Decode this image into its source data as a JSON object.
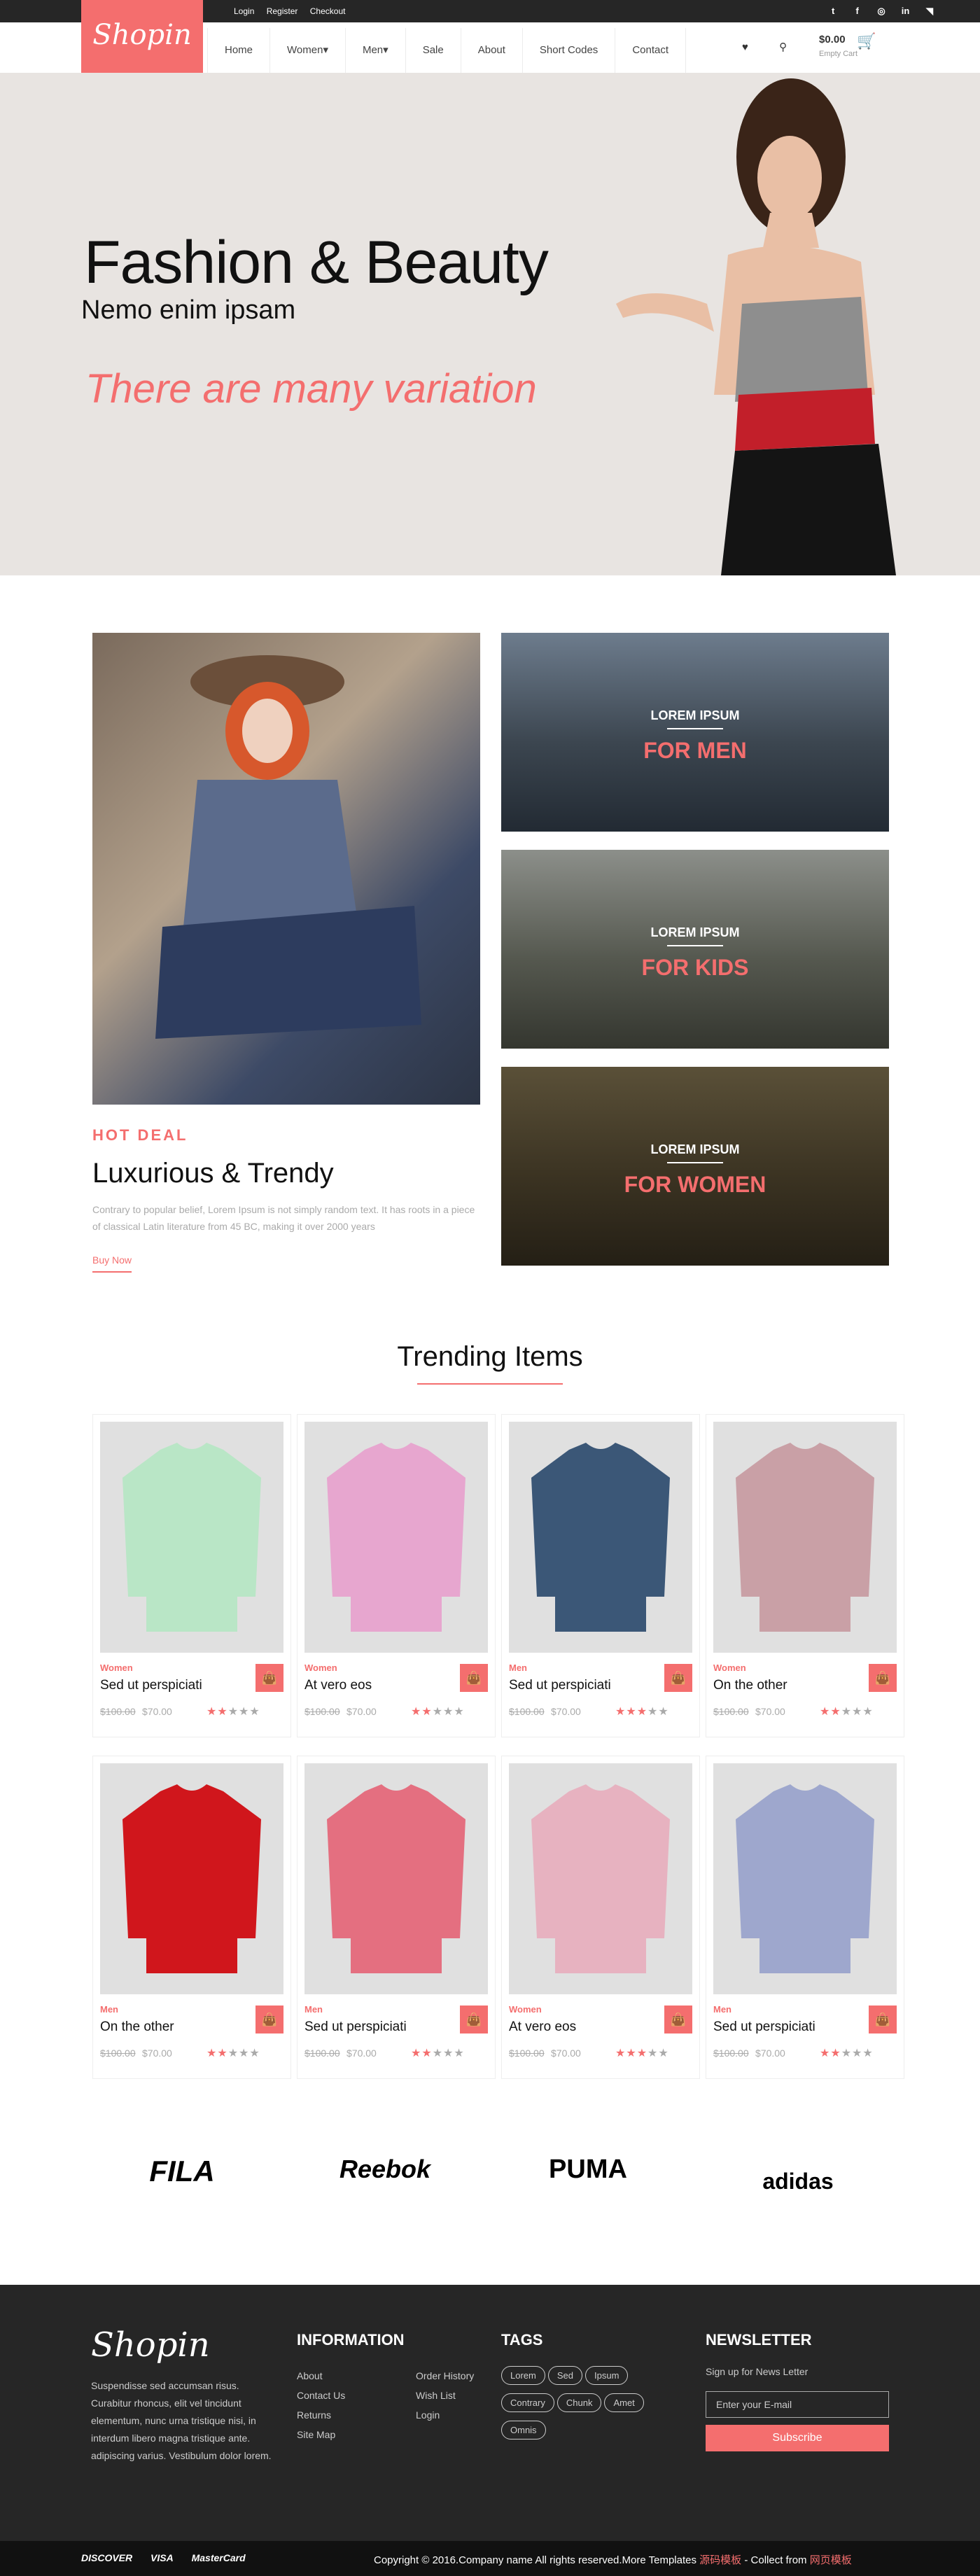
{
  "topbar": {
    "login": "Login",
    "register": "Register",
    "checkout": "Checkout",
    "social": [
      "twitter-icon",
      "facebook-icon",
      "dribbble-icon",
      "linkedin-icon",
      "rss-icon"
    ]
  },
  "logo": "Shopin",
  "nav": [
    "Home",
    "Women",
    "Men",
    "Sale",
    "About",
    "Short Codes",
    "Contact"
  ],
  "cart": {
    "total": "$0.00",
    "label": "Empty Cart"
  },
  "hero": {
    "title": "Fashion & Beauty",
    "subtitle": "Nemo enim ipsam",
    "tagline": "There are many variation"
  },
  "categories": [
    {
      "eyebrow": "LOREM IPSUM",
      "name": "FOR MEN"
    },
    {
      "eyebrow": "LOREM IPSUM",
      "name": "FOR KIDS"
    },
    {
      "eyebrow": "LOREM IPSUM",
      "name": "FOR WOMEN"
    }
  ],
  "deal": {
    "label": "HOT DEAL",
    "title": "Luxurious & Trendy",
    "text": "Contrary to popular belief, Lorem Ipsum is not simply random text. It has roots in a piece of classical Latin literature from 45 BC, making it over 2000 years",
    "link": "Buy Now"
  },
  "trending": {
    "title": "Trending Items"
  },
  "products": [
    {
      "cat": "Women",
      "name": "Sed ut perspiciati",
      "old": "$100.00",
      "price": "$70.00",
      "rating": 2,
      "color": "#b9e6c6"
    },
    {
      "cat": "Women",
      "name": "At vero eos",
      "old": "$100.00",
      "price": "$70.00",
      "rating": 2,
      "color": "#e7a6cf"
    },
    {
      "cat": "Men",
      "name": "Sed ut perspiciati",
      "old": "$100.00",
      "price": "$70.00",
      "rating": 3,
      "color": "#3b5777"
    },
    {
      "cat": "Women",
      "name": "On the other",
      "old": "$100.00",
      "price": "$70.00",
      "rating": 2,
      "color": "#c9a0a6"
    },
    {
      "cat": "Men",
      "name": "On the other",
      "old": "$100.00",
      "price": "$70.00",
      "rating": 2,
      "color": "#d0161c"
    },
    {
      "cat": "Men",
      "name": "Sed ut perspiciati",
      "old": "$100.00",
      "price": "$70.00",
      "rating": 2,
      "color": "#e46f80"
    },
    {
      "cat": "Women",
      "name": "At vero eos",
      "old": "$100.00",
      "price": "$70.00",
      "rating": 3,
      "color": "#e7b2c0"
    },
    {
      "cat": "Men",
      "name": "Sed ut perspiciati",
      "old": "$100.00",
      "price": "$70.00",
      "rating": 2,
      "color": "#9ea7cd"
    }
  ],
  "brands": [
    "FILA",
    "Reebok",
    "PUMA",
    "adidas"
  ],
  "footer": {
    "logo": "Shopin",
    "about": "Suspendisse sed accumsan risus. Curabitur rhoncus, elit vel tincidunt elementum, nunc urna tristique nisi, in interdum libero magna tristique ante. adipiscing varius. Vestibulum dolor lorem.",
    "info_title": "INFORMATION",
    "info_col1": [
      "About",
      "Contact Us",
      "Returns",
      "Site Map"
    ],
    "info_col2": [
      "Order History",
      "Wish List",
      "Login"
    ],
    "tags_title": "TAGS",
    "tags": [
      "Lorem",
      "Sed",
      "Ipsum",
      "Contrary",
      "Chunk",
      "Amet",
      "Omnis"
    ],
    "news_title": "NEWSLETTER",
    "news_text": "Sign up for News Letter",
    "news_placeholder": "Enter your E-mail",
    "news_button": "Subscribe"
  },
  "bottom": {
    "cards": [
      "DISCOVER",
      "VISA",
      "MasterCard"
    ],
    "copy": "Copyright © 2016.Company name All rights reserved.More Templates",
    "link1": "源码模板",
    "sep": "- Collect from",
    "link2": "网页模板"
  }
}
